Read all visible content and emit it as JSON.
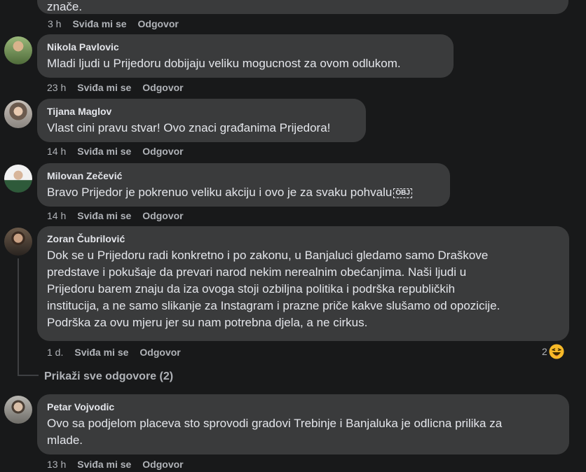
{
  "top": {
    "text_tail": "znače.",
    "time": "3 h",
    "like": "Sviđa mi se",
    "reply": "Odgovor"
  },
  "comments": [
    {
      "author": "Nikola Pavlovic",
      "text": "Mladi ljudi u Prijedoru dobijaju veliku mogucnost za ovom odlukom.",
      "time": "23 h",
      "like": "Sviđa mi se",
      "reply": "Odgovor"
    },
    {
      "author": "Tijana Maglov",
      "text": "Vlast cini pravu stvar! Ovo znaci građanima Prijedora!",
      "time": "14 h",
      "like": "Sviđa mi se",
      "reply": "Odgovor"
    },
    {
      "author": "Milovan Zečević",
      "text": "Bravo Prijedor je pokrenuo veliku akciju i ovo je za svaku pohvalu",
      "obj_icon": "OBJ",
      "time": "14 h",
      "like": "Sviđa mi se",
      "reply": "Odgovor"
    },
    {
      "author": "Zoran Čubrilović",
      "lines": [
        "Dok se u Prijedoru radi konkretno i po zakonu, u Banjaluci gledamo samo Draškove",
        "predstave i pokušaje da prevari narod nekim nerealnim obećanjima. Naši ljudi u",
        "Prijedoru barem znaju da iza ovoga stoji ozbiljna politika i podrška republičkih",
        "institucija, a ne samo slikanje za Instagram i prazne priče kakve slušamo od opozicije.",
        "Podrška za ovu mjeru jer su nam potrebna djela, a ne cirkus."
      ],
      "time": "1 d.",
      "like": "Sviđa mi se",
      "reply": "Odgovor",
      "reaction_count": "2",
      "reaction_icon": "haha-emoji-icon",
      "show_replies": "Prikaži sve odgovore (2)"
    },
    {
      "author": "Petar Vojvodic",
      "lines": [
        "Ovo sa podjelom placeva sto sprovodi gradovi Trebinje i Banjaluka je odlicna prilika za",
        "mlade."
      ],
      "time": "13 h",
      "like": "Sviđa mi se",
      "reply": "Odgovor"
    }
  ],
  "colors": {
    "background": "#18191a",
    "bubble": "#3a3b3c",
    "text": "#e4e6eb",
    "meta": "#b0b3b8",
    "emoji": "#f7b928"
  }
}
